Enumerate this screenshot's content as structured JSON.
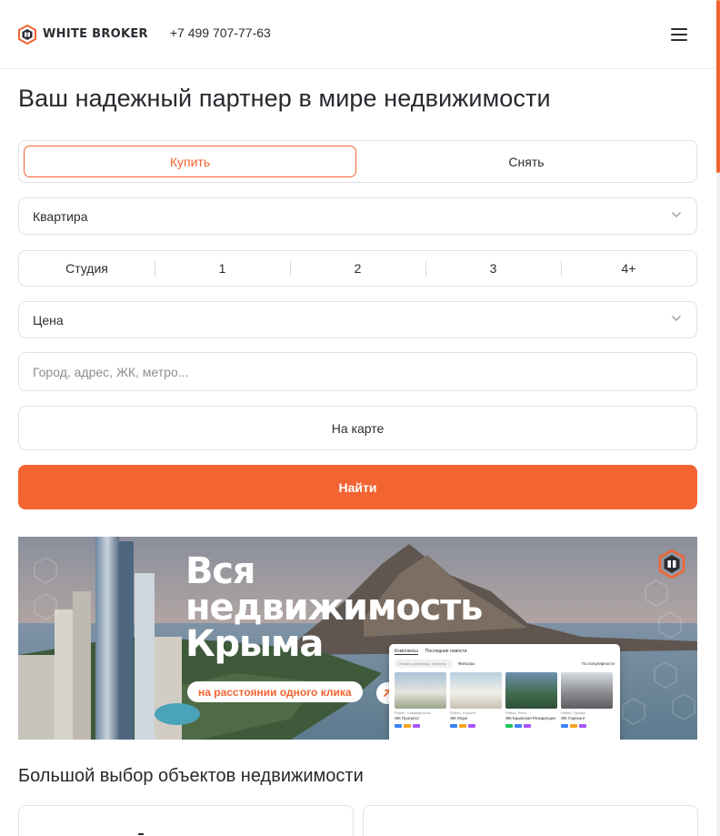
{
  "header": {
    "logo_text": "WHITE BROKER",
    "phone": "+7 499 707-77-63",
    "menu_icon": "burger-menu-icon"
  },
  "title": "Ваш надежный партнер в мире недвижимости",
  "deal_tabs": [
    {
      "label": "Купить",
      "active": true
    },
    {
      "label": "Снять",
      "active": false
    }
  ],
  "property_type": {
    "value": "Квартира"
  },
  "rooms": [
    "Студия",
    "1",
    "2",
    "3",
    "4+"
  ],
  "price": {
    "value": "Цена"
  },
  "search": {
    "placeholder": "Город, адрес, ЖК, метро..."
  },
  "map_button": "На карте",
  "find_button": "Найти",
  "banner": {
    "headline": [
      "Вся",
      "недвижимость",
      "Крыма"
    ],
    "pill": "на расстоянии одного клика",
    "mock": {
      "tabs": [
        "Комплексы",
        "Последние новости"
      ],
      "search_placeholder": "Искать комплексы, объекты",
      "filter_label": "Фильтры",
      "sort_label": "По популярности",
      "cards": [
        {
          "caption": "Район, Симферополь",
          "name": "ЖК Прогресс"
        },
        {
          "caption": "Район, Алушта",
          "name": "ЖК Море"
        },
        {
          "caption": "Район, Ялта",
          "name": "ЖК Крымская Резиденция"
        },
        {
          "caption": "Район, Гурзуф",
          "name": "ЖК Горизонт"
        }
      ]
    }
  },
  "section_title": "Большой выбор объектов недвижимости",
  "colors": {
    "accent": "#f26432",
    "text": "#2a2d33",
    "border": "#e1e2e5",
    "placeholder": "#8a8d93"
  }
}
